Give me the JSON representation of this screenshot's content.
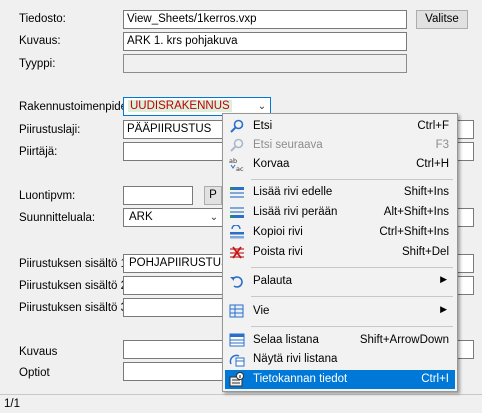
{
  "form": {
    "tiedosto_label": "Tiedosto:",
    "tiedosto_value": "View_Sheets/1kerros.vxp",
    "valitse_label": "Valitse",
    "kuvaus_label": "Kuvaus:",
    "kuvaus_value": "ARK 1. krs pohjakuva",
    "tyyppi_label": "Tyyppi:",
    "rakennusosa_label": "Rakennustoimenpide:",
    "rakennusosa_value": "UUDISRAKENNUS",
    "piirustuslaji_label": "Piirustuslaji:",
    "piirustuslaji_value": "PÄÄPIIRUSTUS",
    "piirtaja_label": "Piirtäjä:",
    "luontipvm_label": "Luontipvm:",
    "luontipvm_button": "P",
    "suunnitteluala_label": "Suunnitteluala:",
    "suunnitteluala_value": "ARK",
    "sisalto1_label": "Piirustuksen sisältö 1:",
    "sisalto1_value": "POHJAPIIRUSTUS",
    "sisalto2_label": "Piirustuksen sisältö 2:",
    "sisalto3_label": "Piirustuksen sisältö 3:",
    "kuvaus2_label": "Kuvaus",
    "optiot_label": "Optiot"
  },
  "status": {
    "record": "1/1"
  },
  "menu": {
    "etsi": {
      "label": "Etsi",
      "shortcut": "Ctrl+F",
      "icon": "search-icon"
    },
    "etsi_seuraava": {
      "label": "Etsi seuraava",
      "shortcut": "F3",
      "icon": "search-next-icon"
    },
    "korvaa": {
      "label": "Korvaa",
      "shortcut": "Ctrl+H",
      "icon": "replace-icon"
    },
    "lisaa_edelle": {
      "label": "Lisää rivi edelle",
      "shortcut": "Shift+Ins",
      "icon": "insert-row-above-icon"
    },
    "lisaa_pera": {
      "label": "Lisää rivi perään",
      "shortcut": "Alt+Shift+Ins",
      "icon": "insert-row-below-icon"
    },
    "kopioi": {
      "label": "Kopioi rivi",
      "shortcut": "Ctrl+Shift+Ins",
      "icon": "copy-row-icon"
    },
    "poista": {
      "label": "Poista rivi",
      "shortcut": "Shift+Del",
      "icon": "delete-row-icon"
    },
    "palauta": {
      "label": "Palauta",
      "icon": "undo-icon"
    },
    "vie": {
      "label": "Vie",
      "icon": "export-icon"
    },
    "selaa": {
      "label": "Selaa listana",
      "shortcut": "Shift+ArrowDown",
      "icon": "list-view-icon"
    },
    "nayta": {
      "label": "Näytä rivi listana",
      "icon": "show-row-list-icon"
    },
    "tietokanta": {
      "label": "Tietokannan tiedot",
      "shortcut": "Ctrl+I",
      "icon": "database-info-icon"
    }
  },
  "colors": {
    "highlight": "#0078d7",
    "red_value": "#c00000"
  }
}
